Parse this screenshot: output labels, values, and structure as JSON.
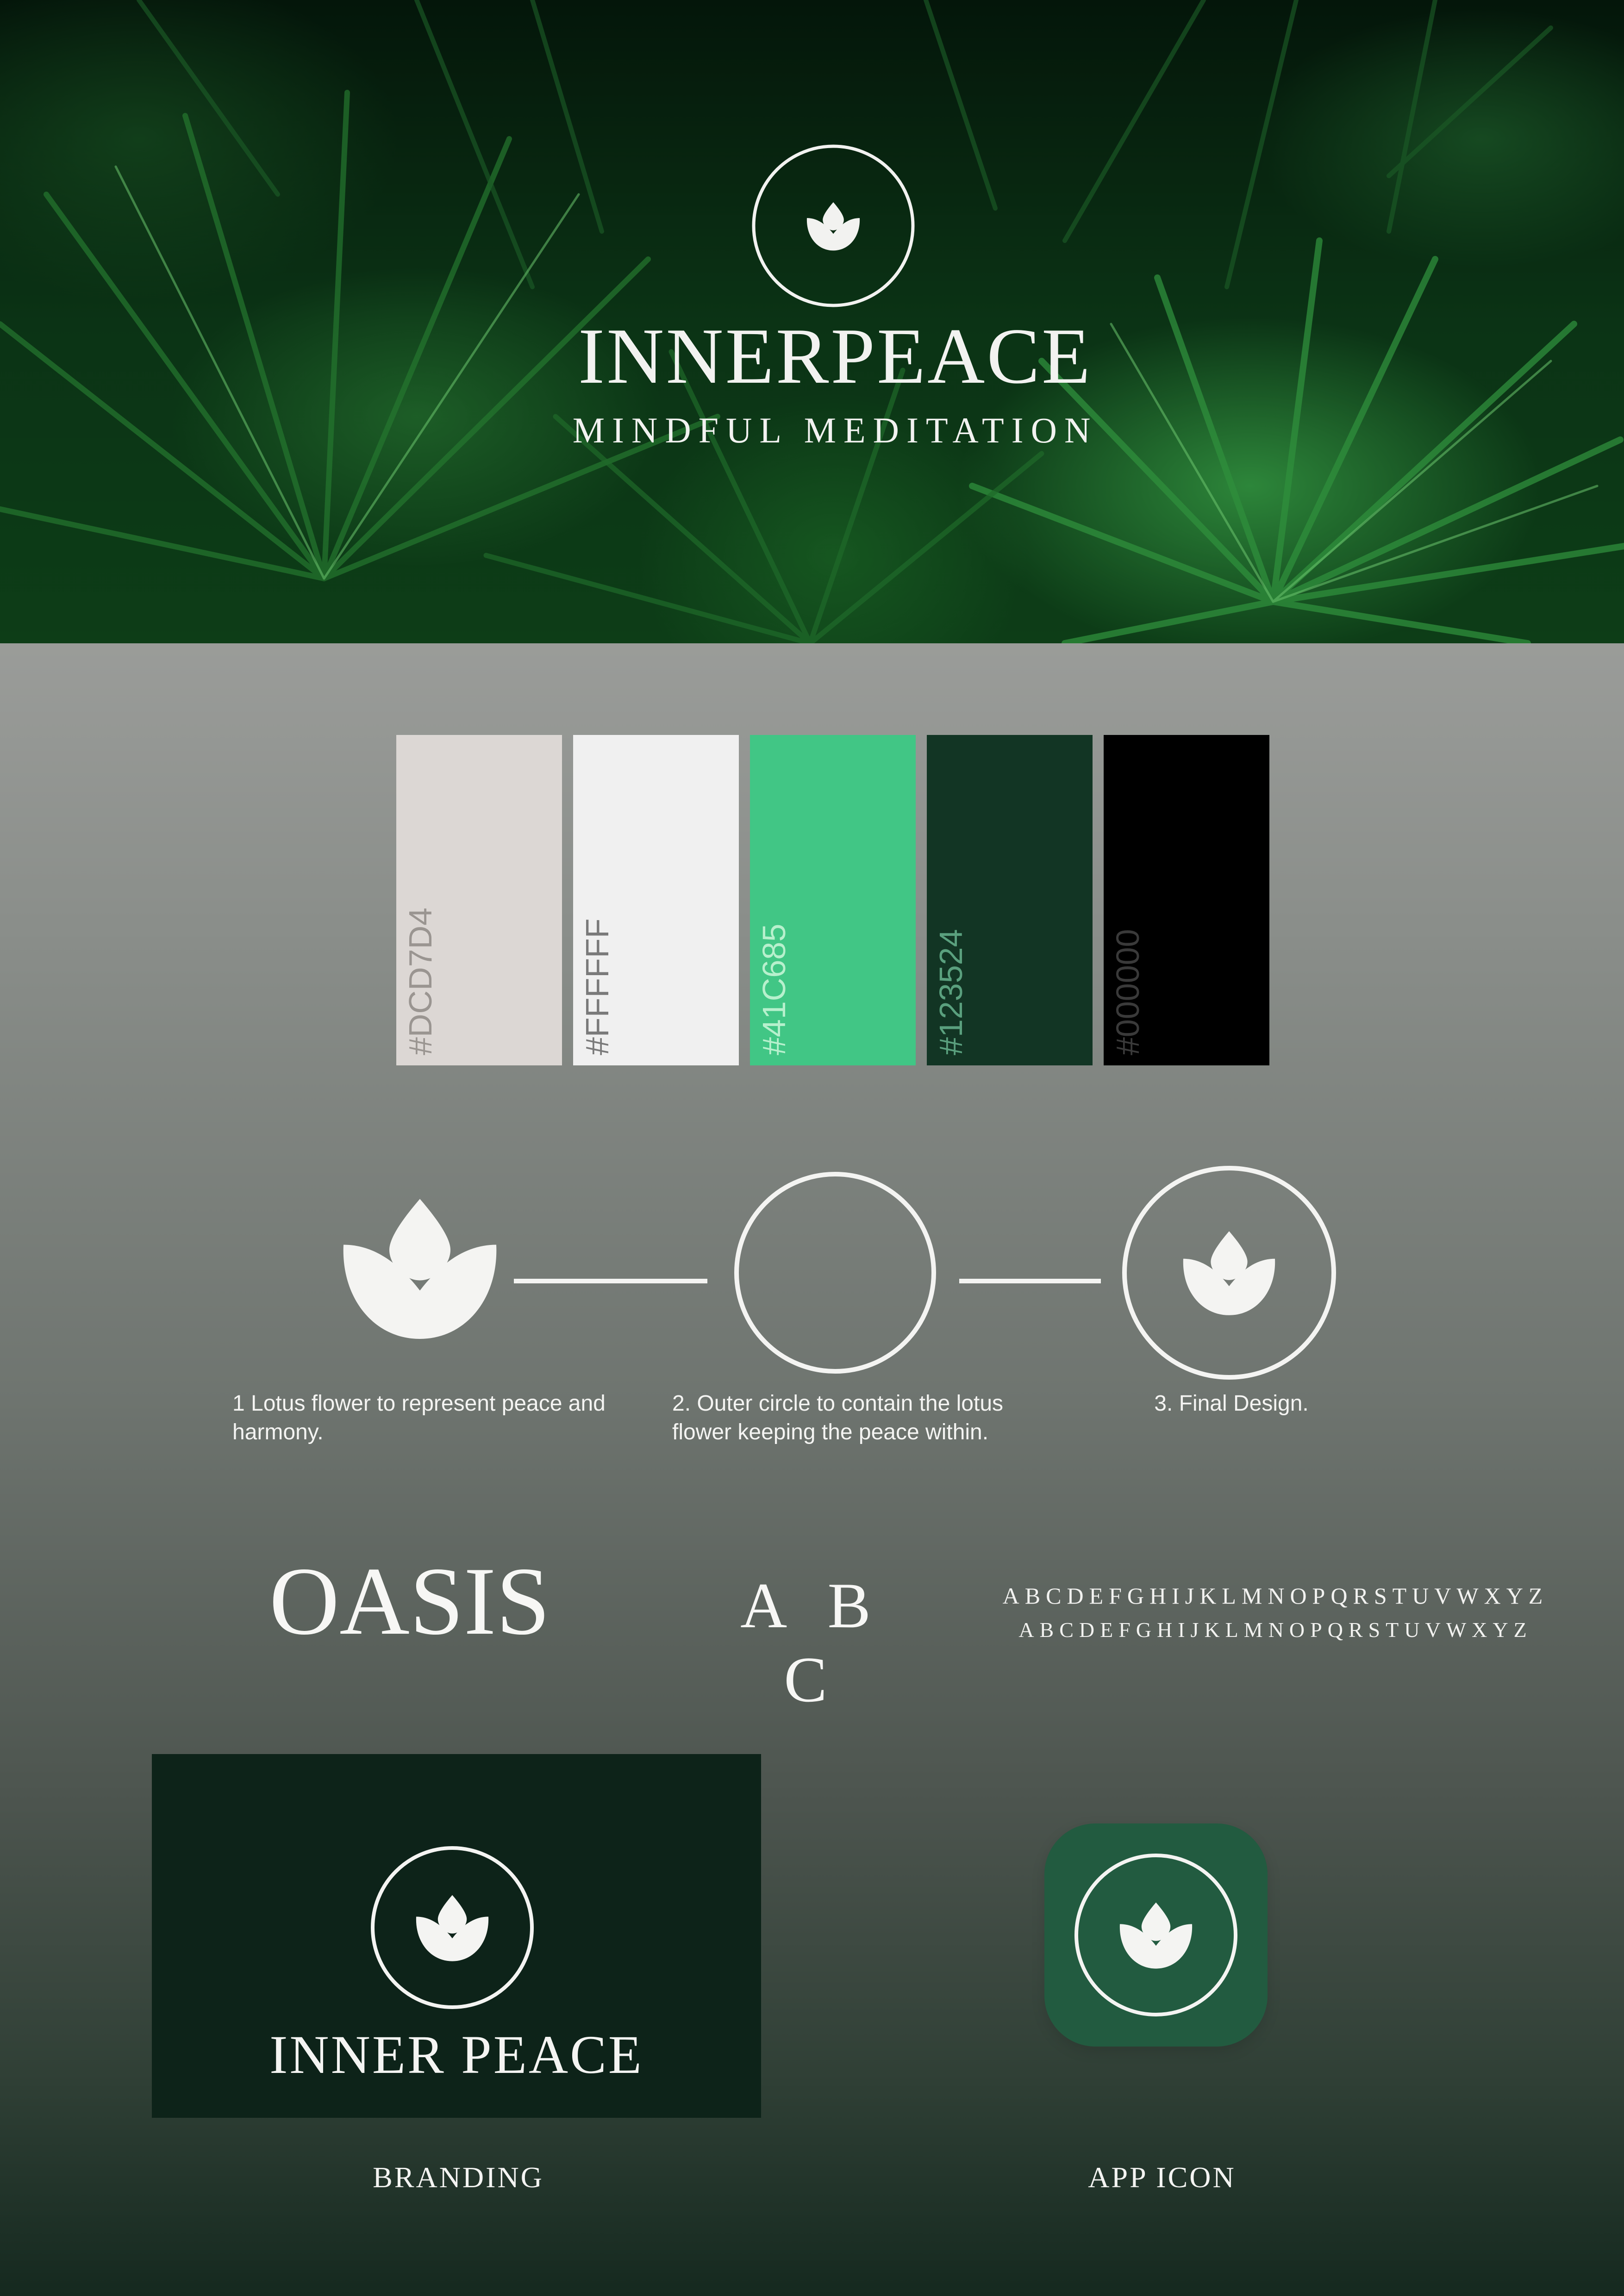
{
  "hero": {
    "title": "INNERPEACE",
    "subtitle": "MINDFUL MEDITATION"
  },
  "palette": [
    {
      "code": "#DCD7D4",
      "fill": "#dcd7d4",
      "text_color": "#9a9591"
    },
    {
      "code": "#FFFFFF",
      "fill": "#f0f0f0",
      "text_color": "#7a7a7a"
    },
    {
      "code": "#41C685",
      "fill": "#41c685",
      "text_color": "#b7f0cd"
    },
    {
      "code": "#123524",
      "fill": "#123524",
      "text_color": "#5aa07e"
    },
    {
      "code": "#000000",
      "fill": "#000000",
      "text_color": "#3a3a3a"
    }
  ],
  "construction": {
    "steps": [
      "1 Lotus flower to represent peace and harmony.",
      "2. Outer circle to contain the lotus flower keeping the peace within.",
      "3. Final Design."
    ]
  },
  "typography": {
    "display_word": "OASIS",
    "sample_letters": "A B C",
    "alphabet_upper": "ABCDEFGHIJKLMNOPQRSTUVWXYZ",
    "alphabet_lower": "ABCDEFGHIJKLMNOPQRSTUVWXYZ"
  },
  "branding": {
    "card_title": "INNER PEACE",
    "label": "BRANDING"
  },
  "app_icon": {
    "label": "APP ICON"
  },
  "colors": {
    "logo_white": "#f4f4f2",
    "branding_bg": "#0d2319",
    "app_icon_bg": "#225b40"
  }
}
